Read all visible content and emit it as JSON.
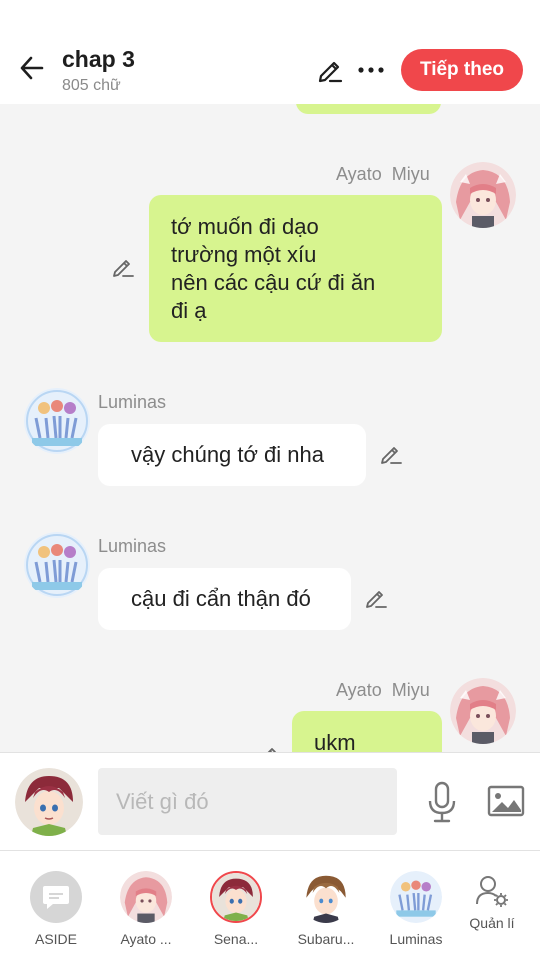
{
  "header": {
    "title": "chap 3",
    "subtitle": "805 chữ",
    "next_label": "Tiếp theo"
  },
  "messages": [
    {
      "side": "right",
      "sender_first": "Ayato",
      "sender_last": "Miyu",
      "text": "tớ muốn đi dạo\ntrường một xíu\nnên các cậu cứ đi ăn\nđi ạ"
    },
    {
      "side": "left",
      "sender": "Luminas",
      "text": "vậy chúng tớ đi nha"
    },
    {
      "side": "left",
      "sender": "Luminas",
      "text": "cậu đi cẩn thận đó"
    },
    {
      "side": "right",
      "sender_first": "Ayato",
      "sender_last": "Miyu",
      "text": "ukm"
    }
  ],
  "composer": {
    "placeholder": "Viết gì đó"
  },
  "bottom_bar": {
    "items": [
      {
        "label": "ASIDE"
      },
      {
        "label": "Ayato ..."
      },
      {
        "label": "Sena..."
      },
      {
        "label": "Subaru..."
      },
      {
        "label": "Luminas"
      },
      {
        "label": "Quản lí"
      }
    ]
  },
  "colors": {
    "accent": "#f0474b",
    "bubble_green": "#d7f48f",
    "bubble_white": "#ffffff",
    "background": "#f4f4f4"
  }
}
